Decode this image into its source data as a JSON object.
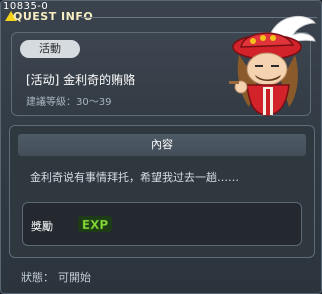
{
  "window": {
    "quest_id": "10835-0",
    "title": "QUEST INFO"
  },
  "quest": {
    "tag": "活動",
    "name": "[活动] 金利奇的贿赂",
    "level_label": "建議等級：",
    "level_range": "30～39"
  },
  "content": {
    "header": "內容",
    "description": "金利奇说有事情拜托，希望我过去一趟……"
  },
  "reward": {
    "label": "獎勵",
    "exp_text": "EXP"
  },
  "status": {
    "label": "狀態：",
    "value": "可開始"
  },
  "colors": {
    "accent_yellow": "#f4d21c",
    "exp_green": "#8be33a"
  },
  "icons": {
    "title": "triangle-icon",
    "reward": "exp-icon",
    "npc": "npc-portrait"
  }
}
